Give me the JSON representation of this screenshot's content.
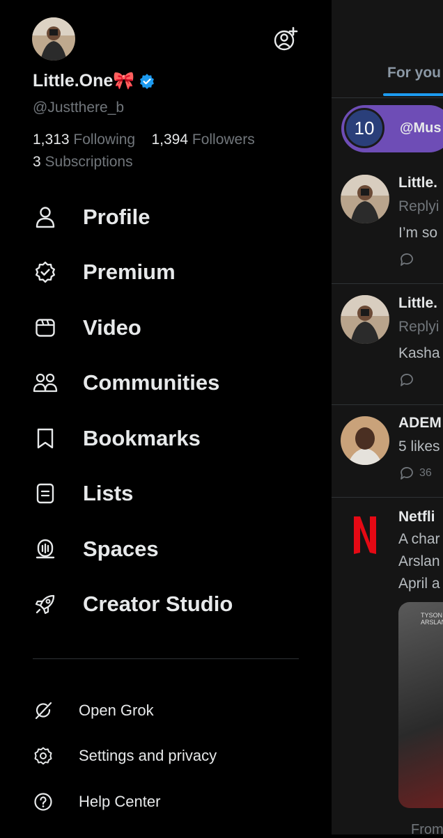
{
  "profile": {
    "display_name": "Little.One",
    "name_emoji": "🎀",
    "handle": "@Justthere_b",
    "following_count": "1,313",
    "following_label": "Following",
    "followers_count": "1,394",
    "followers_label": "Followers",
    "subscriptions_count": "3",
    "subscriptions_label": "Subscriptions"
  },
  "menu": {
    "items": [
      {
        "label": "Profile",
        "icon": "person-icon"
      },
      {
        "label": "Premium",
        "icon": "verified-badge-icon"
      },
      {
        "label": "Video",
        "icon": "video-clapper-icon"
      },
      {
        "label": "Communities",
        "icon": "communities-icon"
      },
      {
        "label": "Bookmarks",
        "icon": "bookmark-icon"
      },
      {
        "label": "Lists",
        "icon": "list-icon"
      },
      {
        "label": "Spaces",
        "icon": "spaces-mic-icon"
      },
      {
        "label": "Creator Studio",
        "icon": "rocket-icon"
      }
    ],
    "secondary": [
      {
        "label": "Open Grok",
        "icon": "grok-icon"
      },
      {
        "label": "Settings and privacy",
        "icon": "gear-icon"
      },
      {
        "label": "Help Center",
        "icon": "help-icon"
      }
    ]
  },
  "feed": {
    "tab_label": "For you",
    "pill_number": "10",
    "pill_text": "@Mus",
    "posts": [
      {
        "name": "Little.",
        "sub": "Replyi",
        "text": "I’m so",
        "icon": "reply-icon"
      },
      {
        "name": "Little.",
        "sub": "Replyi",
        "text": "Kasha",
        "icon": "reply-icon"
      },
      {
        "name": "ADEM",
        "sub": "5 likes",
        "count": "36",
        "icon": "reply-icon"
      },
      {
        "name": "Netfli",
        "lines": [
          "A char",
          "Arslan",
          "April a"
        ],
        "media_text": "TYSON ARSLAN",
        "from_text": "From"
      }
    ]
  },
  "colors": {
    "background": "#000000",
    "text": "#e7e9ea",
    "muted": "#71767b",
    "accent": "#1d9bf0",
    "verified": "#1d9bf0",
    "netflix_red": "#e50914",
    "pill": "#6e4db6"
  }
}
